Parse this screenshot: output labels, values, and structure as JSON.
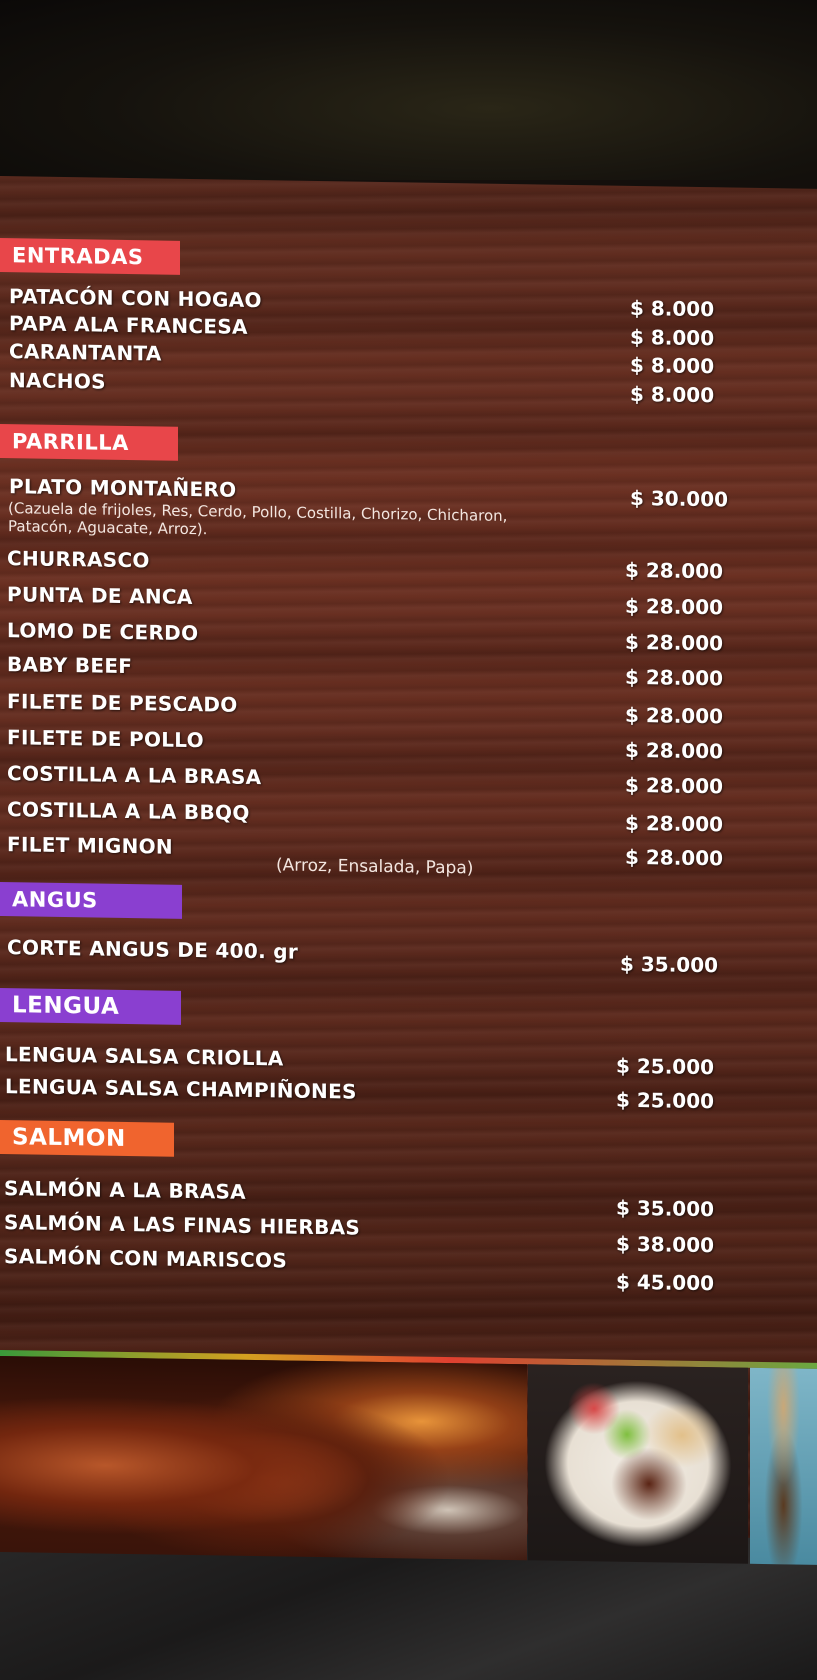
{
  "sections": {
    "entradas": {
      "title": "ENTRADAS",
      "color": "#e8464a",
      "items": [
        {
          "name": "PATACÓN CON  HOGAO",
          "price": "$ 8.000"
        },
        {
          "name": "PAPA ALA FRANCESA",
          "price": "$ 8.000"
        },
        {
          "name": "CARANTANTA",
          "price": "$ 8.000"
        },
        {
          "name": "NACHOS",
          "price": "$ 8.000"
        }
      ]
    },
    "parrilla": {
      "title": "PARRILLA",
      "color": "#e8464a",
      "items": [
        {
          "name": "PLATO MONTAÑERO",
          "price": "$ 30.000",
          "note": "(Cazuela de frijoles, Res, Cerdo, Pollo, Costilla, Chorizo, Chicharon,",
          "note2": "Patacón, Aguacate, Arroz)."
        },
        {
          "name": "CHURRASCO",
          "price": "$ 28.000"
        },
        {
          "name": "PUNTA DE ANCA",
          "price": "$ 28.000"
        },
        {
          "name": "LOMO DE CERDO",
          "price": "$ 28.000"
        },
        {
          "name": "BABY BEEF",
          "price": "$ 28.000"
        },
        {
          "name": "FILETE DE PESCADO",
          "price": "$ 28.000"
        },
        {
          "name": "FILETE DE POLLO",
          "price": "$ 28.000"
        },
        {
          "name": "COSTILLA A LA BRASA",
          "price": "$ 28.000"
        },
        {
          "name": "COSTILLA A LA BBQQ",
          "price": "$ 28.000"
        },
        {
          "name": "FILET MIGNON",
          "price": "$ 28.000"
        }
      ],
      "sides_note": "(Arroz, Ensalada, Papa)"
    },
    "angus": {
      "title": "ANGUS",
      "color": "#8a3fd0",
      "items": [
        {
          "name": "CORTE ANGUS DE 400. gr",
          "price": "$ 35.000"
        }
      ]
    },
    "lengua": {
      "title": "LENGUA",
      "color": "#8a3fd0",
      "items": [
        {
          "name": "LENGUA SALSA CRIOLLA",
          "price": "$ 25.000"
        },
        {
          "name": "LENGUA SALSA CHAMPIÑONES",
          "price": "$ 25.000"
        }
      ]
    },
    "salmon": {
      "title": "SALMON",
      "color": "#f0642e",
      "items": [
        {
          "name": "SALMÓN A LA BRASA",
          "price": "$ 35.000"
        },
        {
          "name": "SALMÓN A LAS FINAS HIERBAS",
          "price": "$ 38.000"
        },
        {
          "name": "SALMÓN CON MARISCOS",
          "price": "$ 45.000"
        }
      ]
    }
  },
  "photos": [
    "grilled-ribs-photo",
    "plated-meal-photo",
    "dish-photo"
  ]
}
